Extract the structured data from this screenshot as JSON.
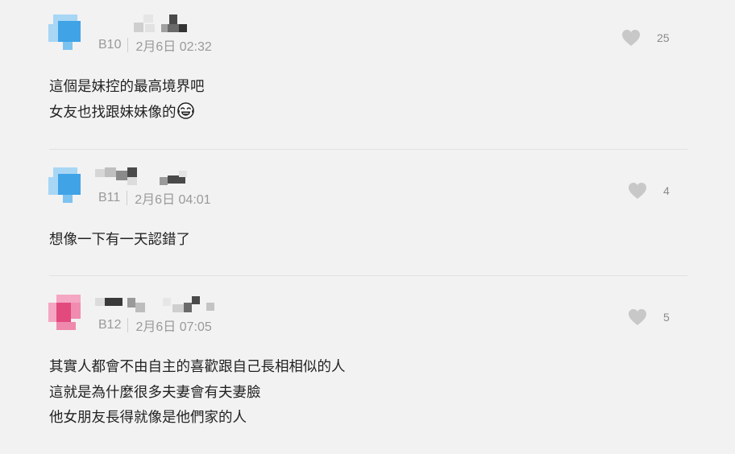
{
  "comments": [
    {
      "floor": "B10",
      "date": "2月6日 02:32",
      "likes": "25",
      "avatar_color": "#3fa3e6",
      "lines": [
        "這個是妹控的最高境界吧",
        "女友也找跟妹妹像的"
      ],
      "emoji": "face-with-tears-of-joy-icon"
    },
    {
      "floor": "B11",
      "date": "2月6日 04:01",
      "likes": "4",
      "avatar_color": "#3fa3e6",
      "lines": [
        "想像一下有一天認錯了"
      ]
    },
    {
      "floor": "B12",
      "date": "2月6日 07:05",
      "likes": "5",
      "avatar_color": "#e24a7e",
      "lines": [
        "其實人都會不由自主的喜歡跟自己長相相似的人",
        "這就是為什麼很多夫妻會有夫妻臉",
        "他女朋友長得就像是他們家的人"
      ]
    }
  ],
  "colors": {
    "background": "#f2f2f2",
    "heart": "#c8c8c8",
    "meta_text": "#9a9a9a",
    "divider": "#e1e1e1"
  }
}
